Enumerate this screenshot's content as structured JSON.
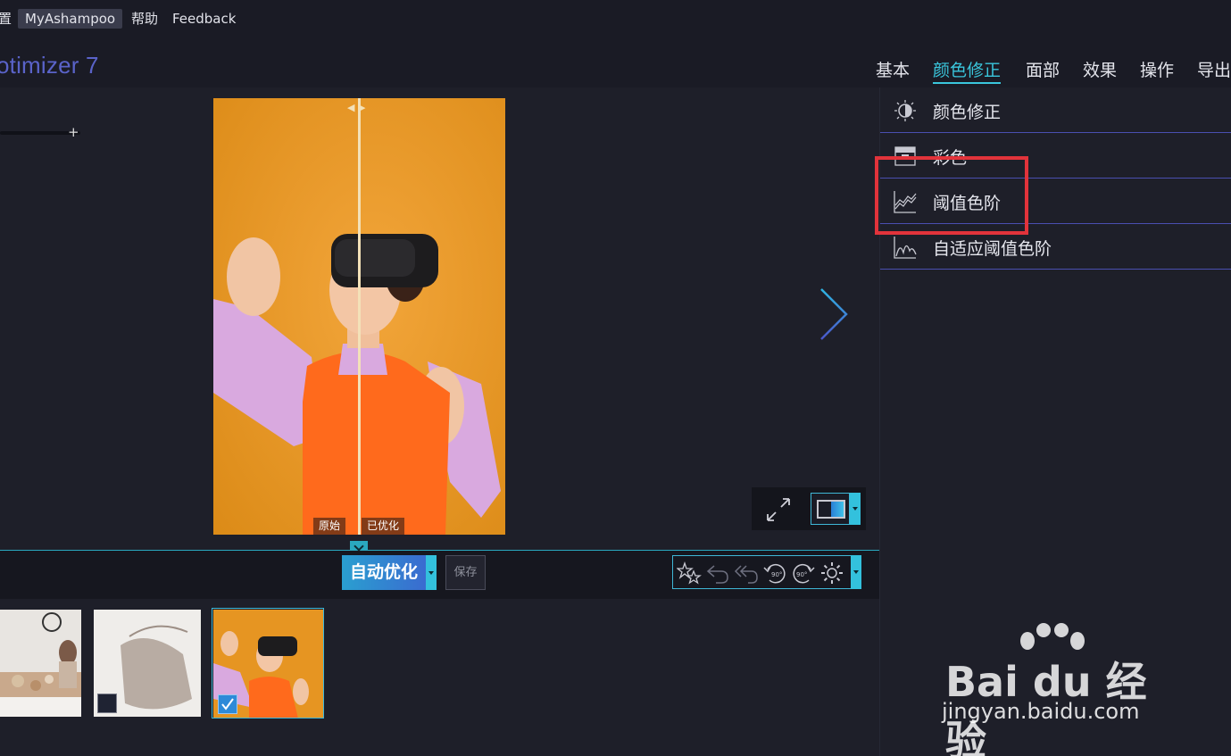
{
  "menu": {
    "items": [
      "置",
      "MyAshampoo",
      "帮助",
      "Feedback"
    ]
  },
  "app": {
    "title": "otimizer 7"
  },
  "tabs": [
    "基本",
    "颜色修正",
    "面部",
    "效果",
    "操作",
    "导出"
  ],
  "active_tab": "颜色修正",
  "photo": {
    "label_original": "原始",
    "label_optimized": "已优化"
  },
  "toolbar": {
    "auto_optimize": "自动优化",
    "save": "保存",
    "rotate_left": "90°",
    "rotate_right": "90°"
  },
  "panel": {
    "items": [
      {
        "label": "颜色修正",
        "icon": "contrast-sun-icon"
      },
      {
        "label": "彩色",
        "icon": "color-fill-icon"
      },
      {
        "label": "阈值色阶",
        "icon": "threshold-graph-icon"
      },
      {
        "label": "自适应阈值色阶",
        "icon": "adaptive-graph-icon"
      }
    ]
  },
  "watermark": {
    "brand": "Bai du 经验",
    "url": "jingyan.baidu.com"
  },
  "colors": {
    "accent": "#3ac6dc",
    "highlight": "#e2333b",
    "background": "#1c1d27"
  }
}
